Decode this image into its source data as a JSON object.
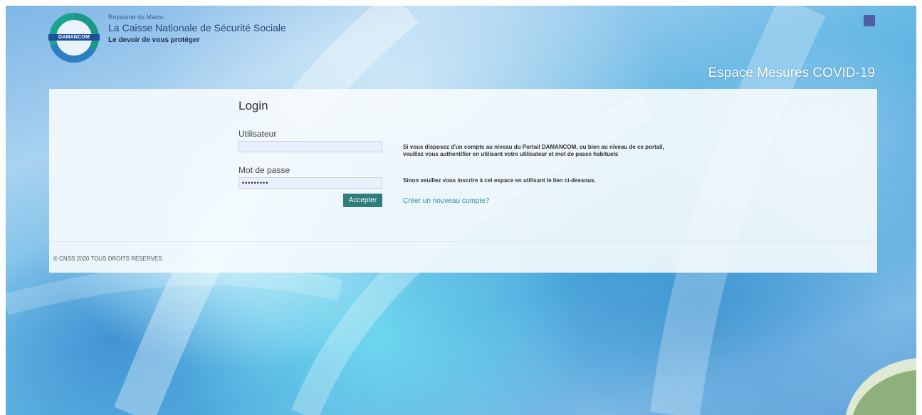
{
  "header": {
    "logo_text": "DAMANCOM",
    "kingdom": "Royaume du Maroc",
    "org_name": "La Caisse Nationale de Sécurité Sociale",
    "tagline": "Le devoir de vous protéger",
    "space_title": "Espace Mesures COVID-19"
  },
  "login": {
    "title": "Login",
    "user_label": "Utilisateur",
    "user_value": "",
    "password_label": "Mot de passe",
    "password_value": "•••••••••",
    "submit_label": "Accepter"
  },
  "info": {
    "line1": "Si vous disposez d'un compte au niveau du Portail DAMANCOM, ou bien au niveau de ce portail,",
    "line2": "veuillez vous authentifier en utilisant votre utilisateur et mot de passe habituels",
    "line3": "Sinon veuillez vous inscrire à cet espace en utilisant le lien ci-dessous.",
    "create_link": "Créer un nouveau compte?"
  },
  "footer": {
    "copyright": "© CNSS 2020 TOUS DROITS RÉSERVÉS"
  },
  "colors": {
    "accent": "#2f7d7b",
    "link": "#2b8fa6",
    "logo_band": "#1d4f9c",
    "corner_square": "#4e5fa5"
  }
}
